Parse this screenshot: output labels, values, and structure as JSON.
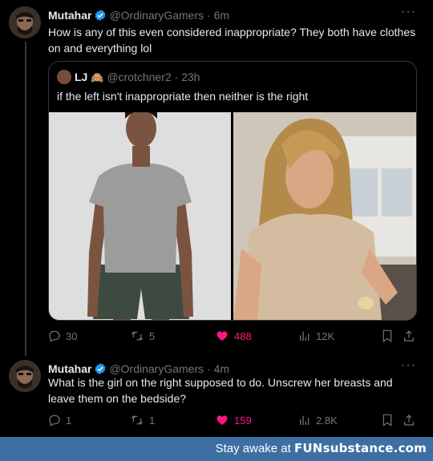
{
  "tweet1": {
    "name": "Mutahar",
    "handle": "@OrdinaryGamers",
    "time": "· 6m",
    "text": "How is any of this even considered  inappropriate? They both have clothes on and everything lol",
    "more": "···",
    "metrics": {
      "replies": "30",
      "retweets": "5",
      "likes": "488",
      "views": "12K"
    }
  },
  "quote": {
    "name": "LJ",
    "emoji": "🙈",
    "handle": "@crotchner2",
    "time": "· 23h",
    "text": "if the left isn't inappropriate then neither is the right"
  },
  "tweet2": {
    "name": "Mutahar",
    "handle": "@OrdinaryGamers",
    "time": "· 4m",
    "text": "What is the girl on the right supposed to do. Unscrew her breasts and leave them on the bedside?",
    "more": "···",
    "metrics": {
      "replies": "1",
      "retweets": "1",
      "likes": "159",
      "views": "2.8K"
    }
  },
  "banner": {
    "prefix": "Stay awake at ",
    "brand": "FUNsubstance.com"
  },
  "colors": {
    "like": "#f91880",
    "verified": "#1d9bf0",
    "muted": "#71767b",
    "banner": "#3e6fa3"
  }
}
